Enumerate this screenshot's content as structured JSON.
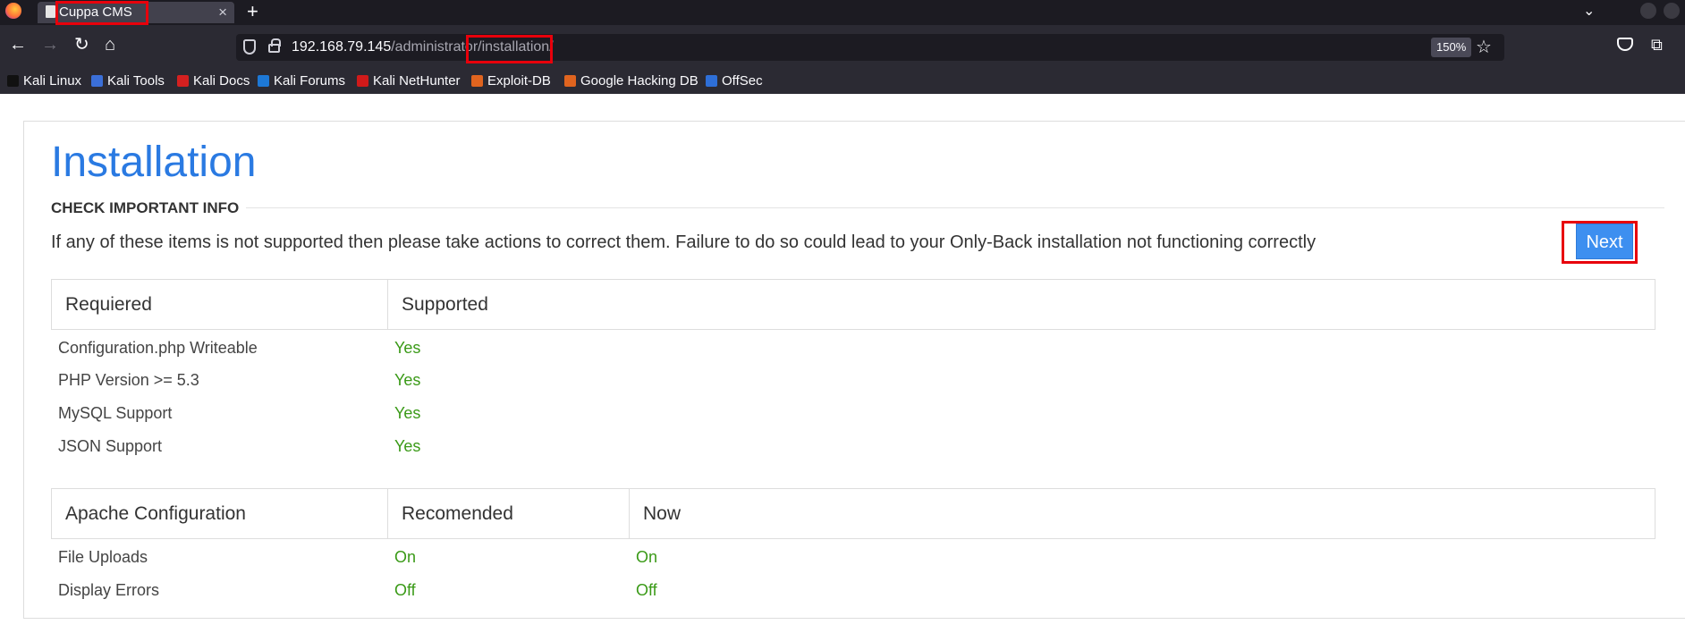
{
  "browser": {
    "tab_title": "Cuppa CMS",
    "url_host": "192.168.79.145",
    "url_path_dim": "/administrator",
    "url_path_highlight": "/installation/",
    "zoom": "150%"
  },
  "bookmarks": [
    {
      "label": "Kali Linux",
      "icon": "kali-dragon-icon",
      "color": "#111111"
    },
    {
      "label": "Kali Tools",
      "icon": "kali-tools-icon",
      "color": "#3b6fd8"
    },
    {
      "label": "Kali Docs",
      "icon": "kali-docs-icon",
      "color": "#d42020"
    },
    {
      "label": "Kali Forums",
      "icon": "kali-forums-icon",
      "color": "#1d78d6"
    },
    {
      "label": "Kali NetHunter",
      "icon": "nethunter-icon",
      "color": "#d01a1a"
    },
    {
      "label": "Exploit-DB",
      "icon": "exploit-db-icon",
      "color": "#e0641f"
    },
    {
      "label": "Google Hacking DB",
      "icon": "ghdb-icon",
      "color": "#e0641f"
    },
    {
      "label": "OffSec",
      "icon": "offsec-icon",
      "color": "#2e6fd8"
    }
  ],
  "page": {
    "title": "Installation",
    "section_heading": "CHECK IMPORTANT INFO",
    "intro": "If any of these items is not supported then please take actions to correct them. Failure to do so could lead to your Only-Back installation not functioning correctly",
    "next_label": "Next"
  },
  "requirements": {
    "headers": [
      "Requiered",
      "Supported"
    ],
    "rows": [
      {
        "item": "Configuration.php Writeable",
        "status": "Yes"
      },
      {
        "item": "PHP Version >= 5.3",
        "status": "Yes"
      },
      {
        "item": "MySQL Support",
        "status": "Yes"
      },
      {
        "item": "JSON Support",
        "status": "Yes"
      }
    ]
  },
  "apache": {
    "headers": [
      "Apache Configuration",
      "Recomended",
      "Now"
    ],
    "rows": [
      {
        "item": "File Uploads",
        "recommended": "On",
        "now": "On"
      },
      {
        "item": "Display Errors",
        "recommended": "Off",
        "now": "Off"
      }
    ]
  },
  "colors": {
    "accent": "#2a7ae2",
    "button": "#3d8ff0",
    "ok": "#3a9a17",
    "highlight": "#e8000b"
  }
}
